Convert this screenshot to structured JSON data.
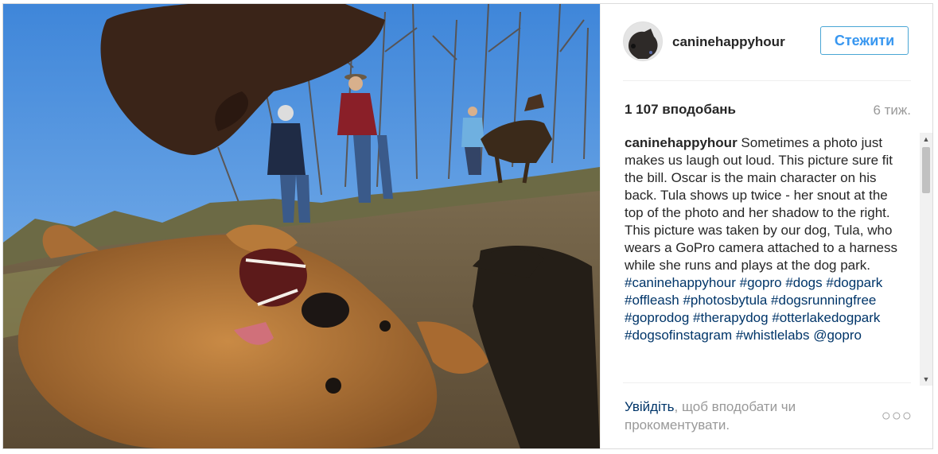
{
  "post": {
    "username": "caninehappyhour",
    "follow_label": "Стежити",
    "likes": "1 107 вподобань",
    "time_ago": "6 тиж.",
    "caption": {
      "username": "caninehappyhour",
      "text": "Sometimes a photo just makes us laugh out loud.  This picture sure fit the bill.  Oscar is the main character on his back.  Tula shows up twice - her snout at the top of the photo and her shadow to the right. This picture was taken by our dog, Tula, who wears a GoPro camera attached to a harness while she runs and plays at the dog park.",
      "tags": [
        "#caninehappyhour",
        "#gopro",
        "#dogs",
        "#dogpark",
        "#offleash",
        "#photosbytula",
        "#dogsrunningfree",
        "#goprodog",
        "#therapydog",
        "#otterlakedogpark",
        "#dogsofinstagram",
        "#whistlelabs",
        "@gopro"
      ]
    },
    "login_link": "Увійдіть",
    "login_rest": ", щоб вподобати чи прокоментувати.",
    "more_icon": "more-dots-icon",
    "colors": {
      "link": "#003569",
      "follow_border": "#4aa6d5",
      "follow_text": "#3897f0",
      "muted": "#999999"
    }
  }
}
